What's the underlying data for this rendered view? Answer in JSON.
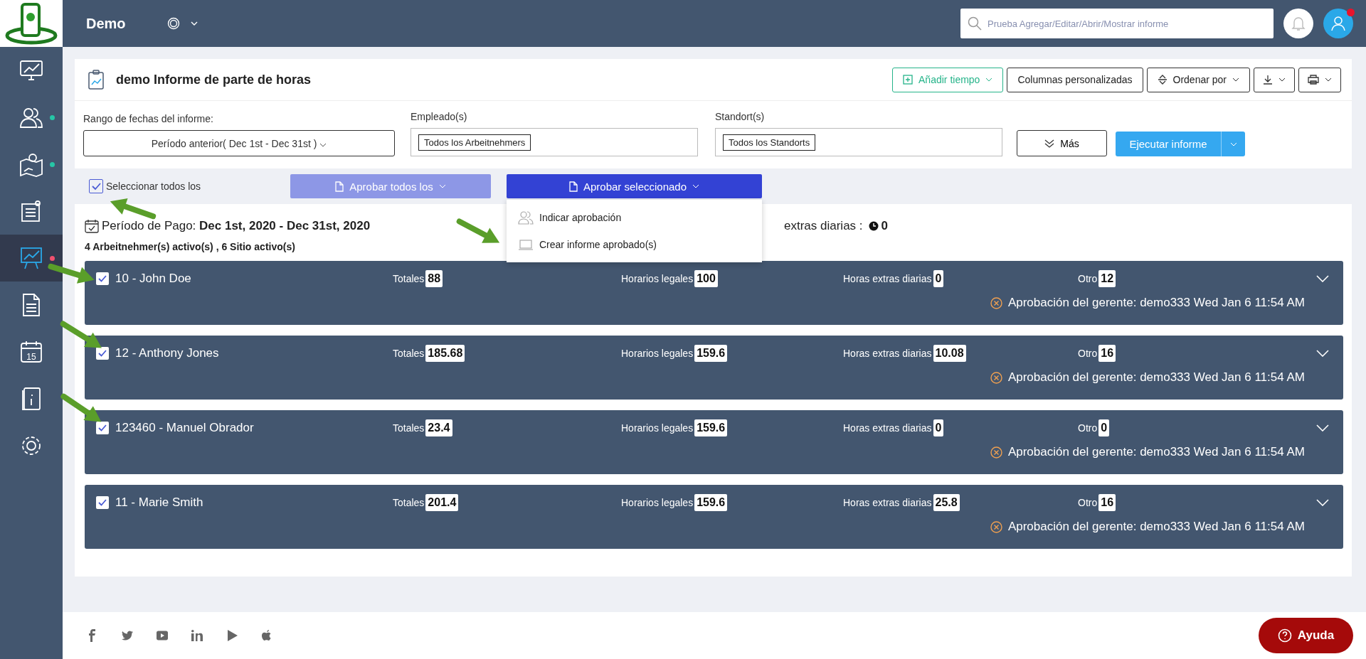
{
  "topbar": {
    "title": "Demo",
    "search": {
      "placeholder": "Prueba Agregar/Editar/Abrir/Mostrar informe"
    },
    "alert": true
  },
  "sidebar": {
    "items": [
      {
        "kind": "monitor",
        "selected": false
      },
      {
        "kind": "users",
        "selected": false,
        "color": "#26c6a6"
      },
      {
        "kind": "map",
        "selected": false,
        "color": "#26c6a6"
      },
      {
        "kind": "notes",
        "selected": false
      },
      {
        "kind": "chart",
        "selected": true,
        "color": "#f0506e"
      },
      {
        "kind": "document",
        "selected": false
      },
      {
        "kind": "calendar",
        "selected": false,
        "day": "15"
      },
      {
        "kind": "book",
        "selected": false
      },
      {
        "kind": "gear",
        "selected": false
      }
    ]
  },
  "report": {
    "title": "demo Informe de parte de horas",
    "actions": [
      {
        "kind": "add",
        "label": "Añadir tiempo"
      },
      {
        "kind": "text",
        "label": "Columnas personalizadas"
      },
      {
        "kind": "sort",
        "label": "Ordenar por"
      },
      {
        "kind": "download"
      },
      {
        "kind": "print"
      }
    ]
  },
  "filters": [
    {
      "kind": "select",
      "label": "Rango de fechas del informe:",
      "value": "Período anterior( Dec 1st - Dec 31st )"
    },
    {
      "kind": "tags",
      "label": "Empleado(s)",
      "tag": "Todos los Arbeitnehmers"
    },
    {
      "kind": "tags",
      "label": "Standort(s)",
      "tag": "Todos los Standorts"
    }
  ],
  "more_button": "Más",
  "run_button": "Ejecutar informe",
  "select_all": {
    "label": "Seleccionar todos los",
    "checked": true
  },
  "approve_all": {
    "label": "Aprobar todos los",
    "disabled": true
  },
  "approve_selected": {
    "label": "Aprobar seleccionado",
    "expanded": true
  },
  "menu": [
    {
      "kind": "users",
      "label": "Indicar aprobación"
    },
    {
      "kind": "laptop",
      "label": "Crear informe aprobado(s)"
    }
  ],
  "summary": {
    "period_label": "Período de Pago:",
    "period": "Dec 1st, 2020 - Dec 31st, 2020",
    "active": "4 Arbeitnehmer(s) activo(s) , 6 Sitio activo(s)",
    "overtime_label": "extras diarias :",
    "overtime": "0"
  },
  "employees": [
    {
      "name": "10 - John Doe",
      "checked": true,
      "stats": [
        {
          "label": "Totales",
          "value": "88"
        },
        {
          "label": "Horarios legales",
          "value": "100"
        },
        {
          "label": "Horas extras diarias",
          "value": "0"
        },
        {
          "label": "Otro",
          "value": "12"
        }
      ],
      "approval": "Aprobación del gerente: demo333 Wed Jan 6 11:54 AM"
    },
    {
      "name": "12 - Anthony Jones",
      "checked": true,
      "stats": [
        {
          "label": "Totales",
          "value": "185.68"
        },
        {
          "label": "Horarios legales",
          "value": "159.6"
        },
        {
          "label": "Horas extras diarias",
          "value": "10.08"
        },
        {
          "label": "Otro",
          "value": "16"
        }
      ],
      "approval": "Aprobación del gerente: demo333 Wed Jan 6 11:54 AM"
    },
    {
      "name": "123460 - Manuel Obrador",
      "checked": true,
      "stats": [
        {
          "label": "Totales",
          "value": "23.4"
        },
        {
          "label": "Horarios legales",
          "value": "159.6"
        },
        {
          "label": "Horas extras diarias",
          "value": "0"
        },
        {
          "label": "Otro",
          "value": "0"
        }
      ],
      "approval": "Aprobación del gerente: demo333 Wed Jan 6 11:54 AM"
    },
    {
      "name": "11 - Marie Smith",
      "checked": true,
      "stats": [
        {
          "label": "Totales",
          "value": "201.4"
        },
        {
          "label": "Horarios legales",
          "value": "159.6"
        },
        {
          "label": "Horas extras diarias",
          "value": "25.8"
        },
        {
          "label": "Otro",
          "value": "16"
        }
      ],
      "approval": "Aprobación del gerente: demo333 Wed Jan 6 11:54 AM"
    }
  ],
  "footer": {
    "help": "Ayuda"
  }
}
